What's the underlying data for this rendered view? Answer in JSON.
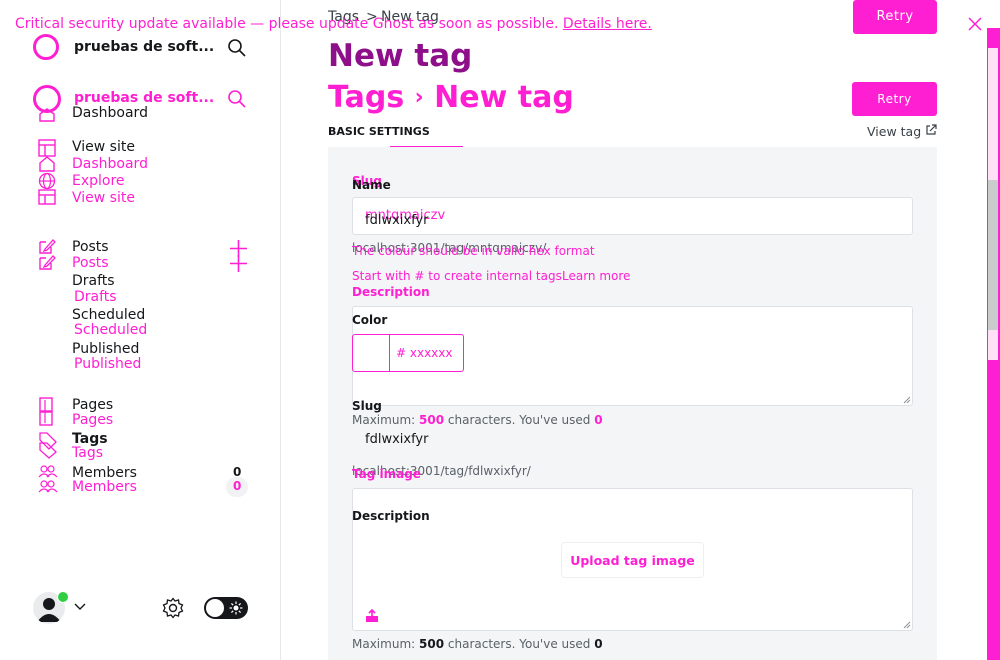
{
  "banner": {
    "text": "Critical security update available — please update Ghost as soon as possible.",
    "link": "Details here."
  },
  "sidebar": {
    "site_name_dark": "pruebas de soft...",
    "site_name_overlay": "pruebas de soft...",
    "nav_dark": {
      "dashboard": "Dashboard",
      "view_site": "View site",
      "posts": "Posts",
      "drafts": "Drafts",
      "scheduled": "Scheduled",
      "published": "Published",
      "pages": "Pages",
      "tags": "Tags",
      "members": "Members",
      "members_count": "0"
    },
    "nav_overlay": {
      "dashboard": "Dashboard",
      "explore": "Explore",
      "view_site": "View site",
      "posts": "Posts",
      "drafts": "Drafts",
      "scheduled": "Scheduled",
      "published": "Published",
      "pages": "Pages",
      "tags": "Tags",
      "members": "Members",
      "members_count": "0"
    }
  },
  "header": {
    "breadcrumb_parent": "Tags",
    "breadcrumb_sep": ">",
    "breadcrumb_current": "New tag",
    "title_dark": "New tag",
    "title_overlay_parent": "Tags",
    "title_overlay_current": "New tag",
    "retry_label": "Retry",
    "retry_label_overlay": "Retry",
    "tab_basic": "BASIC SETTINGS",
    "view_tag": "View tag"
  },
  "form": {
    "slug_label_overlay": "Slug",
    "name_label": "Name",
    "name_value": "fdlwxixfyr",
    "name_value_overlay": "mntqmaiczv",
    "url_hint_overlay": "localhost:3001/tag/mntqmaiczv/",
    "color_error": "The colour should be in valid hex format",
    "name_hint": "Start with # to create internal tags",
    "learn_more": "Learn more",
    "description_label_overlay": "Description",
    "color_label": "Color",
    "color_placeholder": "# xxxxxx",
    "slug_label": "Slug",
    "description_counter_overlay_prefix": "Maximum:",
    "description_counter_overlay_max": "500",
    "description_counter_overlay_mid": "characters. You've used",
    "description_counter_overlay_used": "0",
    "slug_value": "fdlwxixfyr",
    "slug_url": "localhost:3001/tag/fdlwxixfyr/",
    "tag_image_label_overlay": "Tag image",
    "description_label": "Description",
    "upload_label": "Upload tag image",
    "counter_prefix": "Maximum:",
    "counter_max": "500",
    "counter_mid": "characters. You've used",
    "counter_used": "0"
  },
  "colors": {
    "accent": "#ff1fd2",
    "title_purple": "#8e0f8a",
    "panel_bg": "#f4f5f6"
  }
}
